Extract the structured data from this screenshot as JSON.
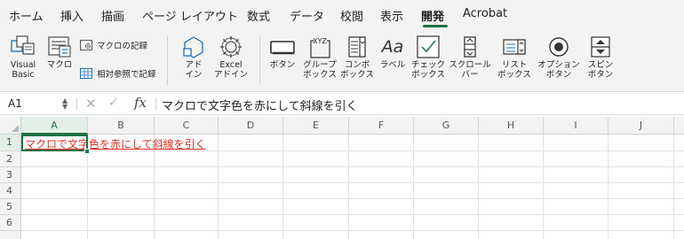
{
  "ribbon_tabs": [
    "ホーム",
    "挿入",
    "描画",
    "ページ レイアウト",
    "数式",
    "データ",
    "校閲",
    "表示",
    "開発",
    "Acrobat"
  ],
  "active_tab": "開発",
  "ribbon": {
    "visual_basic": "Visual\nBasic",
    "macro": "マクロ",
    "record_macro": "マクロの記録",
    "relative_ref": "相対参照で記録",
    "addins": "アド\nイン",
    "excel_addins": "Excel\nアドイン",
    "button": "ボタン",
    "group_box": "グループ\nボックス",
    "combo_box": "コンボ\nボックス",
    "label": "ラベル",
    "check_box": "チェック\nボックス",
    "scroll_bar": "スクロール\nバー",
    "list_box": "リスト\nボックス",
    "option_button": "オプション\nボタン",
    "spin_button": "スピン\nボタン",
    "group_box_icon_text": "XYZ",
    "label_icon_text": "Aa"
  },
  "formula_bar": {
    "name_box": "A1",
    "fx": "fx",
    "content": "マクロで文字色を赤にして斜線を引く"
  },
  "grid": {
    "columns": [
      "A",
      "B",
      "C",
      "D",
      "E",
      "F",
      "G",
      "H",
      "I",
      "J"
    ],
    "rows": [
      "1",
      "2",
      "3",
      "4",
      "5",
      "6"
    ],
    "a1_value": "マクロで文字色を赤にして斜線を引く",
    "selected_cell": "A1",
    "a1_text_color": "#e0312a"
  },
  "colors": {
    "accent": "#1e7145",
    "ribbon_bg": "#f3f3f3"
  }
}
